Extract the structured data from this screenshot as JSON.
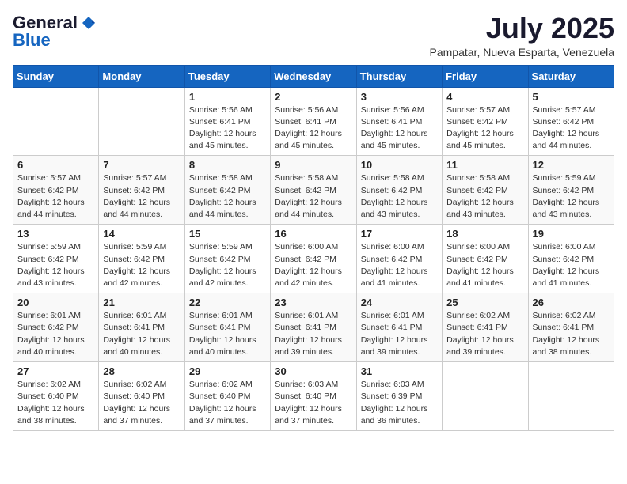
{
  "logo": {
    "general": "General",
    "blue": "Blue"
  },
  "title": "July 2025",
  "location": "Pampatar, Nueva Esparta, Venezuela",
  "days_header": [
    "Sunday",
    "Monday",
    "Tuesday",
    "Wednesday",
    "Thursday",
    "Friday",
    "Saturday"
  ],
  "weeks": [
    [
      {
        "day": "",
        "detail": ""
      },
      {
        "day": "",
        "detail": ""
      },
      {
        "day": "1",
        "detail": "Sunrise: 5:56 AM\nSunset: 6:41 PM\nDaylight: 12 hours\nand 45 minutes."
      },
      {
        "day": "2",
        "detail": "Sunrise: 5:56 AM\nSunset: 6:41 PM\nDaylight: 12 hours\nand 45 minutes."
      },
      {
        "day": "3",
        "detail": "Sunrise: 5:56 AM\nSunset: 6:41 PM\nDaylight: 12 hours\nand 45 minutes."
      },
      {
        "day": "4",
        "detail": "Sunrise: 5:57 AM\nSunset: 6:42 PM\nDaylight: 12 hours\nand 45 minutes."
      },
      {
        "day": "5",
        "detail": "Sunrise: 5:57 AM\nSunset: 6:42 PM\nDaylight: 12 hours\nand 44 minutes."
      }
    ],
    [
      {
        "day": "6",
        "detail": "Sunrise: 5:57 AM\nSunset: 6:42 PM\nDaylight: 12 hours\nand 44 minutes."
      },
      {
        "day": "7",
        "detail": "Sunrise: 5:57 AM\nSunset: 6:42 PM\nDaylight: 12 hours\nand 44 minutes."
      },
      {
        "day": "8",
        "detail": "Sunrise: 5:58 AM\nSunset: 6:42 PM\nDaylight: 12 hours\nand 44 minutes."
      },
      {
        "day": "9",
        "detail": "Sunrise: 5:58 AM\nSunset: 6:42 PM\nDaylight: 12 hours\nand 44 minutes."
      },
      {
        "day": "10",
        "detail": "Sunrise: 5:58 AM\nSunset: 6:42 PM\nDaylight: 12 hours\nand 43 minutes."
      },
      {
        "day": "11",
        "detail": "Sunrise: 5:58 AM\nSunset: 6:42 PM\nDaylight: 12 hours\nand 43 minutes."
      },
      {
        "day": "12",
        "detail": "Sunrise: 5:59 AM\nSunset: 6:42 PM\nDaylight: 12 hours\nand 43 minutes."
      }
    ],
    [
      {
        "day": "13",
        "detail": "Sunrise: 5:59 AM\nSunset: 6:42 PM\nDaylight: 12 hours\nand 43 minutes."
      },
      {
        "day": "14",
        "detail": "Sunrise: 5:59 AM\nSunset: 6:42 PM\nDaylight: 12 hours\nand 42 minutes."
      },
      {
        "day": "15",
        "detail": "Sunrise: 5:59 AM\nSunset: 6:42 PM\nDaylight: 12 hours\nand 42 minutes."
      },
      {
        "day": "16",
        "detail": "Sunrise: 6:00 AM\nSunset: 6:42 PM\nDaylight: 12 hours\nand 42 minutes."
      },
      {
        "day": "17",
        "detail": "Sunrise: 6:00 AM\nSunset: 6:42 PM\nDaylight: 12 hours\nand 41 minutes."
      },
      {
        "day": "18",
        "detail": "Sunrise: 6:00 AM\nSunset: 6:42 PM\nDaylight: 12 hours\nand 41 minutes."
      },
      {
        "day": "19",
        "detail": "Sunrise: 6:00 AM\nSunset: 6:42 PM\nDaylight: 12 hours\nand 41 minutes."
      }
    ],
    [
      {
        "day": "20",
        "detail": "Sunrise: 6:01 AM\nSunset: 6:42 PM\nDaylight: 12 hours\nand 40 minutes."
      },
      {
        "day": "21",
        "detail": "Sunrise: 6:01 AM\nSunset: 6:41 PM\nDaylight: 12 hours\nand 40 minutes."
      },
      {
        "day": "22",
        "detail": "Sunrise: 6:01 AM\nSunset: 6:41 PM\nDaylight: 12 hours\nand 40 minutes."
      },
      {
        "day": "23",
        "detail": "Sunrise: 6:01 AM\nSunset: 6:41 PM\nDaylight: 12 hours\nand 39 minutes."
      },
      {
        "day": "24",
        "detail": "Sunrise: 6:01 AM\nSunset: 6:41 PM\nDaylight: 12 hours\nand 39 minutes."
      },
      {
        "day": "25",
        "detail": "Sunrise: 6:02 AM\nSunset: 6:41 PM\nDaylight: 12 hours\nand 39 minutes."
      },
      {
        "day": "26",
        "detail": "Sunrise: 6:02 AM\nSunset: 6:41 PM\nDaylight: 12 hours\nand 38 minutes."
      }
    ],
    [
      {
        "day": "27",
        "detail": "Sunrise: 6:02 AM\nSunset: 6:40 PM\nDaylight: 12 hours\nand 38 minutes."
      },
      {
        "day": "28",
        "detail": "Sunrise: 6:02 AM\nSunset: 6:40 PM\nDaylight: 12 hours\nand 37 minutes."
      },
      {
        "day": "29",
        "detail": "Sunrise: 6:02 AM\nSunset: 6:40 PM\nDaylight: 12 hours\nand 37 minutes."
      },
      {
        "day": "30",
        "detail": "Sunrise: 6:03 AM\nSunset: 6:40 PM\nDaylight: 12 hours\nand 37 minutes."
      },
      {
        "day": "31",
        "detail": "Sunrise: 6:03 AM\nSunset: 6:39 PM\nDaylight: 12 hours\nand 36 minutes."
      },
      {
        "day": "",
        "detail": ""
      },
      {
        "day": "",
        "detail": ""
      }
    ]
  ]
}
